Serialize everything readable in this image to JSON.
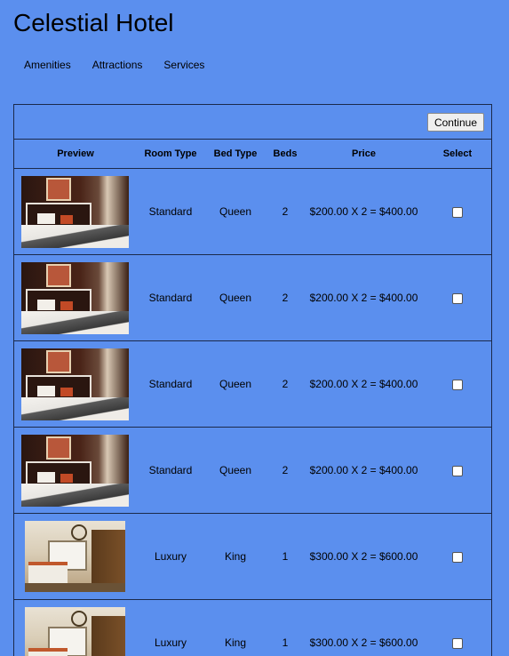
{
  "site": {
    "title": "Celestial Hotel"
  },
  "nav": {
    "items": [
      "Amenities",
      "Attractions",
      "Services"
    ]
  },
  "toolbar": {
    "continue_label": "Continue"
  },
  "table": {
    "headers": {
      "preview": "Preview",
      "room_type": "Room Type",
      "bed_type": "Bed Type",
      "beds": "Beds",
      "price": "Price",
      "select": "Select"
    },
    "rows": [
      {
        "image": "standard-room-photo",
        "room_type": "Standard",
        "bed_type": "Queen",
        "beds": "2",
        "price": "$200.00 X 2 = $400.00",
        "selected": false
      },
      {
        "image": "standard-room-photo",
        "room_type": "Standard",
        "bed_type": "Queen",
        "beds": "2",
        "price": "$200.00 X 2 = $400.00",
        "selected": false
      },
      {
        "image": "standard-room-photo",
        "room_type": "Standard",
        "bed_type": "Queen",
        "beds": "2",
        "price": "$200.00 X 2 = $400.00",
        "selected": false
      },
      {
        "image": "standard-room-photo",
        "room_type": "Standard",
        "bed_type": "Queen",
        "beds": "2",
        "price": "$200.00 X 2 = $400.00",
        "selected": false
      },
      {
        "image": "luxury-room-photo",
        "room_type": "Luxury",
        "bed_type": "King",
        "beds": "1",
        "price": "$300.00 X 2 = $600.00",
        "selected": false
      },
      {
        "image": "luxury-room-photo",
        "room_type": "Luxury",
        "bed_type": "King",
        "beds": "1",
        "price": "$300.00 X 2 = $600.00",
        "selected": false
      }
    ]
  },
  "colors": {
    "background": "#5b8fee",
    "border": "#1b2a4a"
  }
}
